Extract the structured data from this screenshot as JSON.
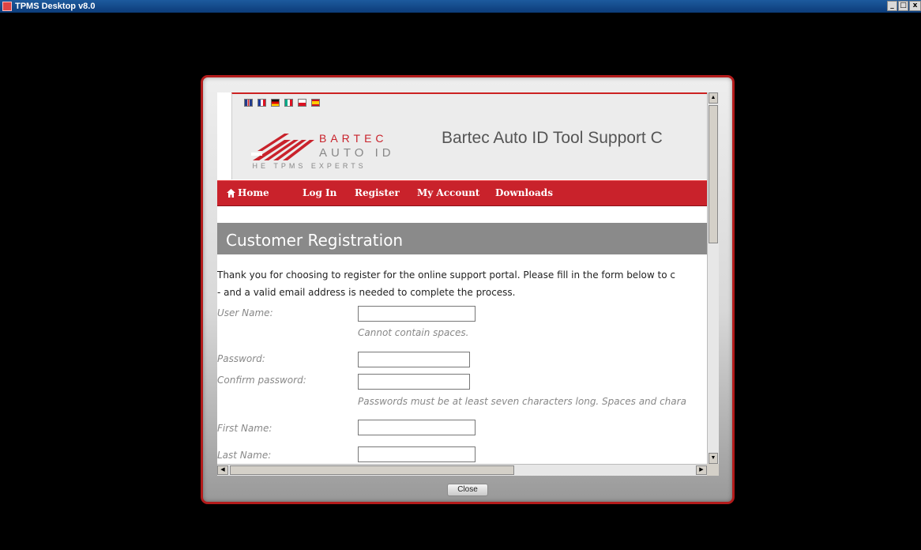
{
  "window": {
    "title": "TPMS Desktop v8.0",
    "minimize": "_",
    "maximize": "□",
    "close": "x"
  },
  "header": {
    "flags": [
      "uk-flag",
      "france-flag",
      "germany-flag",
      "italy-flag",
      "poland-flag",
      "spain-flag"
    ],
    "logo": {
      "line1": "BARTEC",
      "line2": "AUTO ID",
      "tagline": "THE TPMS EXPERTS"
    },
    "site_title": "Bartec Auto ID Tool Support C"
  },
  "nav": {
    "items": [
      "Home",
      "Log In",
      "Register",
      "My Account",
      "Downloads"
    ]
  },
  "page": {
    "title": "Customer Registration",
    "intro_line1": "Thank you for choosing to register for the online support portal. Please fill in the form below to c",
    "intro_line2": "- and a valid email address is needed to complete the process."
  },
  "form": {
    "username_label": "User Name:",
    "username_value": "",
    "username_hint": "Cannot contain spaces.",
    "password_label": "Password:",
    "password_value": "",
    "confirm_label": "Confirm password:",
    "confirm_value": "",
    "password_hint": "Passwords must be at least seven characters long. Spaces and chara",
    "firstname_label": "First Name:",
    "firstname_value": "",
    "lastname_label": "Last Name:",
    "lastname_value": ""
  },
  "dialog": {
    "close_label": "Close"
  },
  "colors": {
    "brand_red": "#c9222b",
    "band_gray": "#8a8a8a",
    "background": "#000000"
  }
}
